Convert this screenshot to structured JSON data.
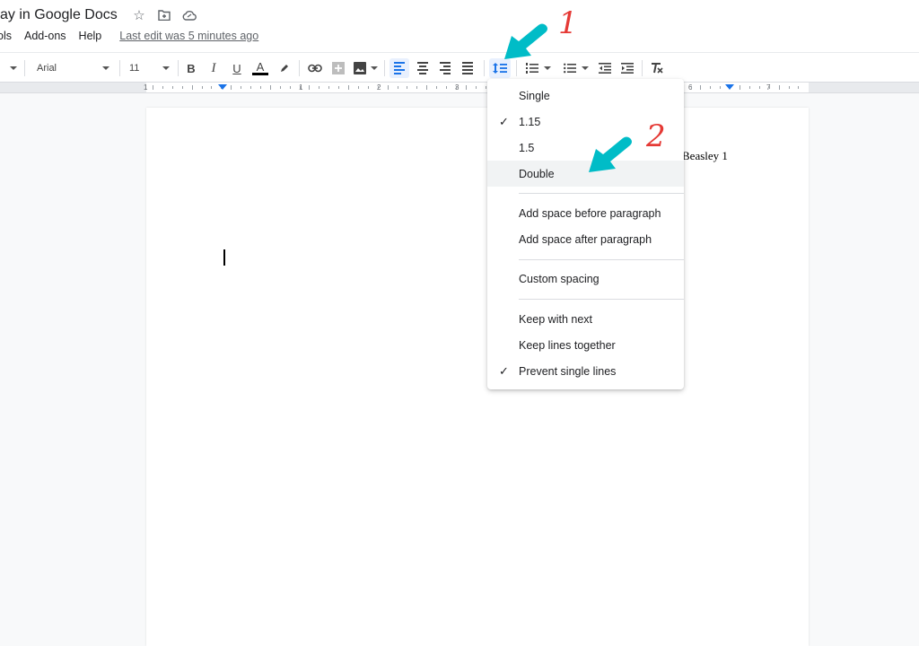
{
  "document": {
    "title": "ay in Google Docs",
    "header_text": "Beasley 1"
  },
  "title_icons": [
    "star-icon",
    "move-to-folder-icon",
    "cloud-saved-icon"
  ],
  "menubar": {
    "items": [
      "ols",
      "Add-ons",
      "Help"
    ],
    "last_edit": "Last edit was 5 minutes ago"
  },
  "toolbar": {
    "font_family": "Arial",
    "font_size": "11",
    "bold": "B",
    "italic": "I",
    "underline": "U",
    "text_color": "A",
    "text_color_value": "#000000",
    "accent_color": "#1a73e8"
  },
  "ruler": {
    "labels": [
      "1",
      "1",
      "2",
      "3",
      "6",
      "7"
    ]
  },
  "line_spacing_menu": {
    "items": [
      {
        "label": "Single",
        "checked": false
      },
      {
        "label": "1.15",
        "checked": true
      },
      {
        "label": "1.5",
        "checked": false
      },
      {
        "label": "Double",
        "checked": false,
        "highlighted": true
      }
    ],
    "paragraph_items": [
      {
        "label": "Add space before paragraph"
      },
      {
        "label": "Add space after paragraph"
      }
    ],
    "custom_items": [
      {
        "label": "Custom spacing"
      }
    ],
    "pagination_items": [
      {
        "label": "Keep with next",
        "checked": false
      },
      {
        "label": "Keep lines together",
        "checked": false
      },
      {
        "label": "Prevent single lines",
        "checked": true
      }
    ],
    "check_glyph": "✓"
  },
  "annotations": {
    "step1": "1",
    "step2": "2",
    "arrow_color": "#00bcc7",
    "number_color": "#e53935"
  }
}
